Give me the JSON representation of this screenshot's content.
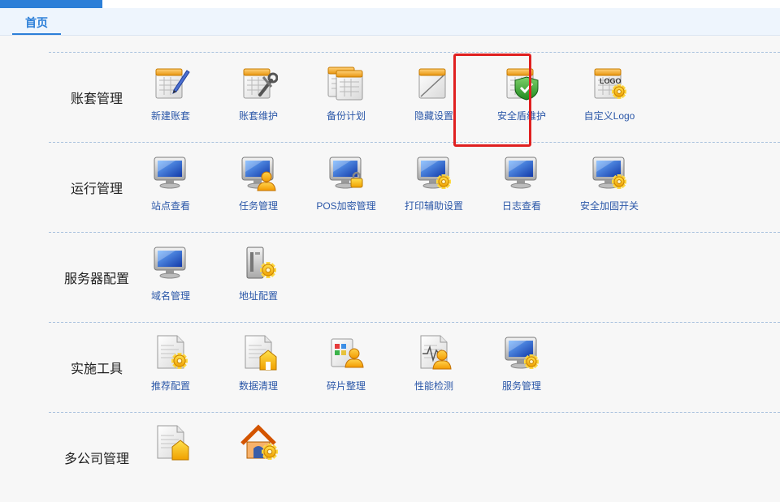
{
  "header": {
    "tab_home": "首页",
    "accent_color": "#2c7fd8"
  },
  "sections": [
    {
      "title": "账套管理",
      "items": [
        {
          "label": "新建账套",
          "icon": "new-ledger-icon"
        },
        {
          "label": "账套维护",
          "icon": "ledger-maintenance-icon"
        },
        {
          "label": "备份计划",
          "icon": "backup-plan-icon"
        },
        {
          "label": "隐藏设置",
          "icon": "hide-settings-icon"
        },
        {
          "label": "安全盾维护",
          "icon": "security-shield-icon"
        },
        {
          "label": "自定义Logo",
          "icon": "custom-logo-icon"
        }
      ]
    },
    {
      "title": "运行管理",
      "items": [
        {
          "label": "站点查看",
          "icon": "site-view-icon"
        },
        {
          "label": "任务管理",
          "icon": "task-management-icon"
        },
        {
          "label": "POS加密管理",
          "icon": "pos-encryption-icon"
        },
        {
          "label": "打印辅助设置",
          "icon": "print-settings-icon"
        },
        {
          "label": "日志查看",
          "icon": "log-view-icon"
        },
        {
          "label": "安全加固开关",
          "icon": "security-hardening-icon"
        }
      ]
    },
    {
      "title": "服务器配置",
      "items": [
        {
          "label": "域名管理",
          "icon": "domain-management-icon"
        },
        {
          "label": "地址配置",
          "icon": "address-config-icon"
        }
      ]
    },
    {
      "title": "实施工具",
      "items": [
        {
          "label": "推荐配置",
          "icon": "recommended-config-icon"
        },
        {
          "label": "数据清理",
          "icon": "data-cleanup-icon"
        },
        {
          "label": "碎片整理",
          "icon": "defragment-icon"
        },
        {
          "label": "性能检测",
          "icon": "performance-check-icon"
        },
        {
          "label": "服务管理",
          "icon": "service-management-icon"
        }
      ]
    },
    {
      "title": "多公司管理",
      "items": [
        {
          "label": "",
          "icon": "company-document-icon"
        },
        {
          "label": "",
          "icon": "company-home-icon"
        }
      ]
    }
  ],
  "highlight_color": "#e02020"
}
